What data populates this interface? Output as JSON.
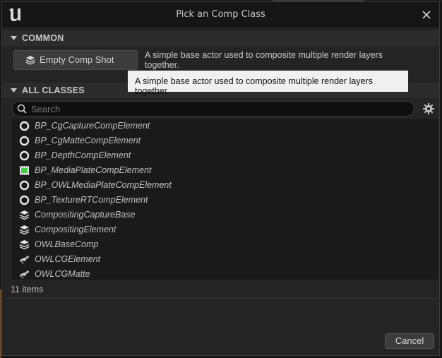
{
  "window": {
    "title": "Pick an Comp Class"
  },
  "common": {
    "header": "COMMON",
    "button_label": "Empty Comp Shot",
    "description": "A simple base actor used to composite multiple render layers together."
  },
  "tooltip": {
    "text": "A simple base actor used to composite multiple render layers together."
  },
  "all_classes": {
    "header": "ALL CLASSES",
    "search_placeholder": "Search",
    "items": [
      {
        "label": "BP_CgCaptureCompElement",
        "icon": "ring-icon"
      },
      {
        "label": "BP_CgMatteCompElement",
        "icon": "ring-icon"
      },
      {
        "label": "BP_DepthCompElement",
        "icon": "ring-icon"
      },
      {
        "label": "BP_MediaPlateCompElement",
        "icon": "media-plate-icon"
      },
      {
        "label": "BP_OWLMediaPlateCompElement",
        "icon": "ring-icon"
      },
      {
        "label": "BP_TextureRTCompElement",
        "icon": "ring-icon"
      },
      {
        "label": "CompositingCaptureBase",
        "icon": "layers-icon"
      },
      {
        "label": "CompositingElement",
        "icon": "layers-icon"
      },
      {
        "label": "OWLBaseComp",
        "icon": "layers-icon"
      },
      {
        "label": "OWLCGElement",
        "icon": "satellite-icon"
      },
      {
        "label": "OWLCGMatte",
        "icon": "satellite-icon"
      }
    ],
    "count": "11 items"
  },
  "footer": {
    "cancel_label": "Cancel"
  }
}
